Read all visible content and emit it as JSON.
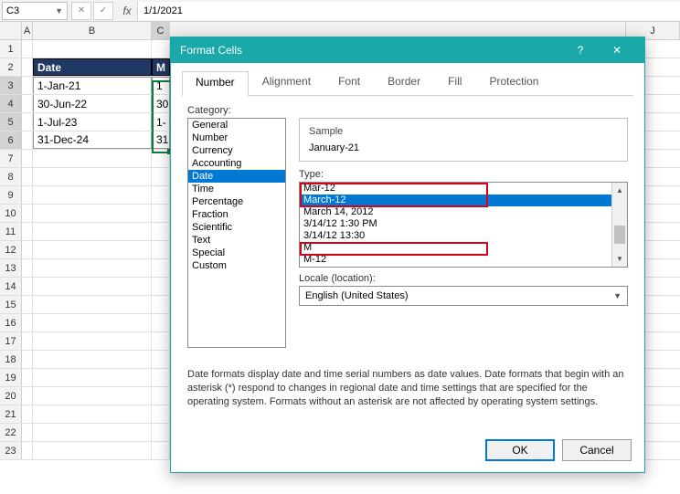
{
  "namebox": "C3",
  "formula_value": "1/1/2021",
  "columns": {
    "A": "A",
    "B": "B",
    "C": "C",
    "J": "J"
  },
  "row_headers": [
    1,
    2,
    3,
    4,
    5,
    6,
    7,
    8,
    9,
    10,
    11,
    12,
    13,
    14,
    15,
    16,
    17,
    18,
    19,
    20,
    21,
    22,
    23
  ],
  "table": {
    "header_B": "Date",
    "header_C": "M",
    "rows": [
      {
        "B": "1-Jan-21",
        "C": "1"
      },
      {
        "B": "30-Jun-22",
        "C": "30"
      },
      {
        "B": "1-Jul-23",
        "C": "1-"
      },
      {
        "B": "31-Dec-24",
        "C": "31"
      }
    ]
  },
  "dialog": {
    "title": "Format Cells",
    "tabs": [
      "Number",
      "Alignment",
      "Font",
      "Border",
      "Fill",
      "Protection"
    ],
    "active_tab": 0,
    "category_label": "Category:",
    "categories": [
      "General",
      "Number",
      "Currency",
      "Accounting",
      "Date",
      "Time",
      "Percentage",
      "Fraction",
      "Scientific",
      "Text",
      "Special",
      "Custom"
    ],
    "category_selected": 4,
    "sample_label": "Sample",
    "sample_value": "January-21",
    "type_label": "Type:",
    "types": [
      "Mar-12",
      "March-12",
      "March 14, 2012",
      "3/14/12 1:30 PM",
      "3/14/12 13:30",
      "M",
      "M-12"
    ],
    "type_selected": 1,
    "locale_label": "Locale (location):",
    "locale_value": "English (United States)",
    "description": "Date formats display date and time serial numbers as date values.  Date formats that begin with an asterisk (*) respond to changes in regional date and time settings that are specified for the operating system. Formats without an asterisk are not affected by operating system settings.",
    "ok": "OK",
    "cancel": "Cancel"
  }
}
